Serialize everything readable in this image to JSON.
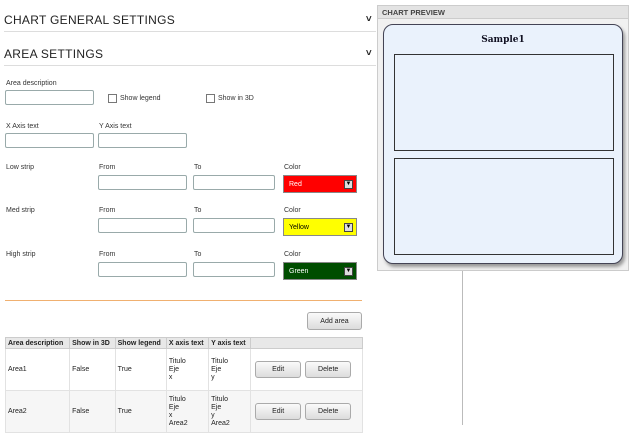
{
  "sections": {
    "general_title": "CHART GENERAL SETTINGS",
    "area_title": "AREA SETTINGS"
  },
  "form": {
    "area_description_label": "Area description",
    "area_description_value": "",
    "show_legend_label": "Show legend",
    "show_3d_label": "Show in 3D",
    "x_axis_label": "X Axis text",
    "y_axis_label": "Y Axis text",
    "from_label": "From",
    "to_label": "To",
    "color_label": "Color",
    "strips": [
      {
        "label": "Low strip",
        "color_name": "Red",
        "color_hex": "#ff0000",
        "text_color": "#ffffff"
      },
      {
        "label": "Med strip",
        "color_name": "Yellow",
        "color_hex": "#ffff00",
        "text_color": "#000000"
      },
      {
        "label": "High strip",
        "color_name": "Green",
        "color_hex": "#004d00",
        "text_color": "#ffffff"
      }
    ],
    "add_area_label": "Add area"
  },
  "table": {
    "headers": [
      "Area description",
      "Show in 3D",
      "Show legend",
      "X axis text",
      "Y axis text"
    ],
    "rows": [
      {
        "desc": "Area1",
        "show3d": "False",
        "legend": "True",
        "x": [
          "Titulo",
          "Eje",
          "x"
        ],
        "y": [
          "Titulo",
          "Eje",
          "y"
        ]
      },
      {
        "desc": "Area2",
        "show3d": "False",
        "legend": "True",
        "x": [
          "Titulo",
          "Eje",
          "x",
          "Area2"
        ],
        "y": [
          "Titulo",
          "Eje",
          "y",
          "Area2"
        ]
      }
    ],
    "edit_label": "Edit",
    "delete_label": "Delete"
  },
  "preview": {
    "header": "CHART PREVIEW",
    "chart_title": "Sample1"
  },
  "icons": {
    "collapse": "chevron-down-icon",
    "dropdown": "dropdown-arrow-icon"
  }
}
